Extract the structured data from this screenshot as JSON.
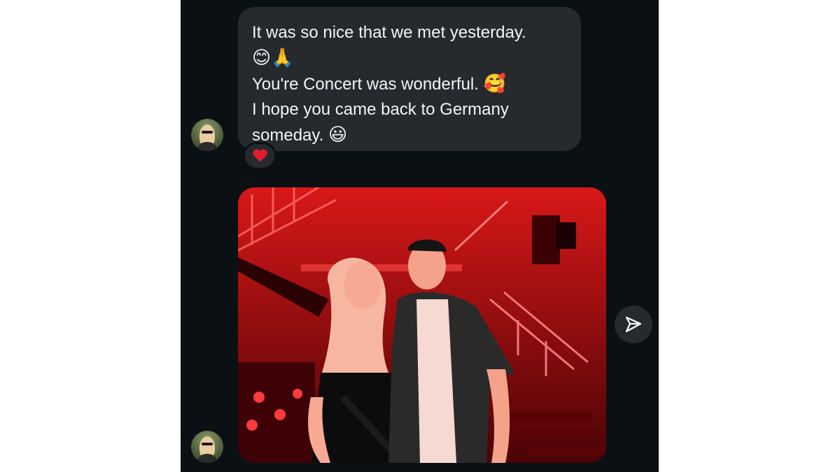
{
  "message": {
    "line1": "It was so nice that we met yesterday.",
    "emoji1": "😊🙏",
    "line2": "You're Concert was wonderful.",
    "emoji2": "🥰",
    "line3": "I hope you came back to Germany",
    "line4": "someday.",
    "emoji3": "😃"
  },
  "reaction": {
    "icon": "heart-icon"
  },
  "photo": {
    "description_icon": "photo-icon"
  },
  "actions": {
    "share_icon": "send-icon"
  },
  "colors": {
    "background": "#0b1014",
    "bubble": "#262a2f",
    "text": "#f3f4f6",
    "reaction_heart": "#e11d2e"
  }
}
